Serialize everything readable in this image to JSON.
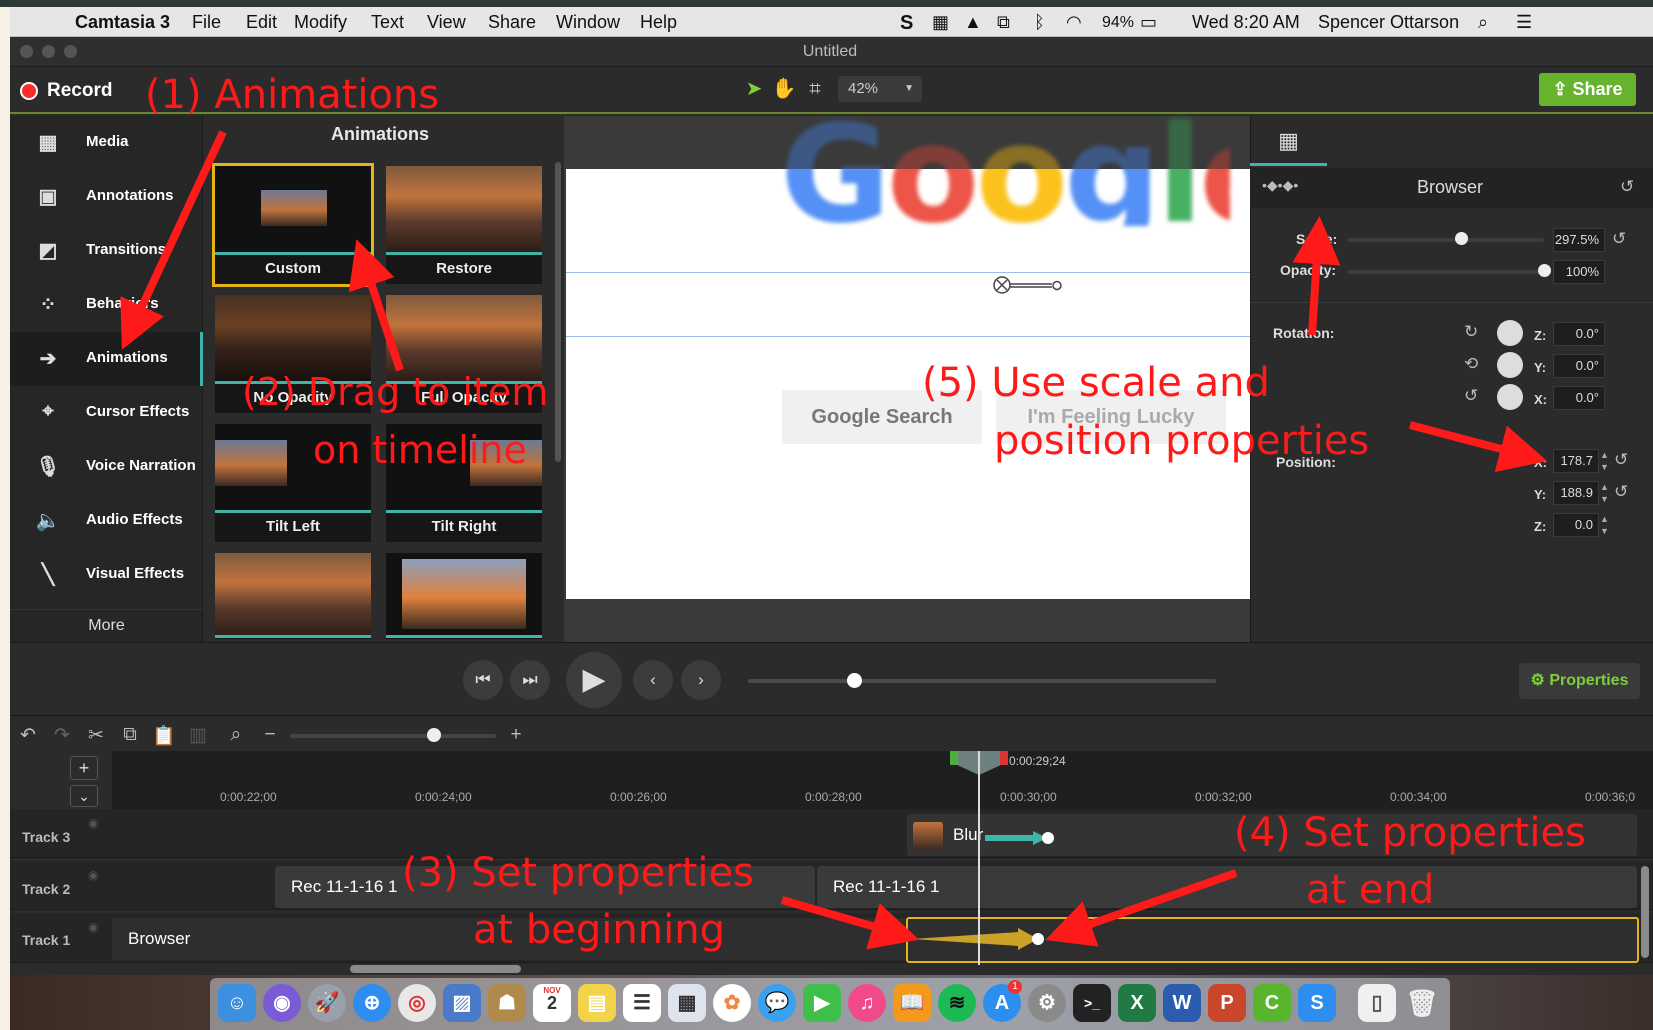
{
  "menubar": {
    "app": "Camtasia 3",
    "items": [
      "File",
      "Edit",
      "Modify",
      "Text",
      "View",
      "Share",
      "Window",
      "Help"
    ],
    "battery": "94%",
    "clock": "Wed 8:20 AM",
    "user": "Spencer Ottarson"
  },
  "window": {
    "title": "Untitled"
  },
  "toolbar": {
    "record_label": "Record",
    "zoom": "42%",
    "share_label": "Share"
  },
  "sidebar": {
    "items": [
      {
        "label": "Media",
        "icon": "film-icon"
      },
      {
        "label": "Annotations",
        "icon": "annotation-icon"
      },
      {
        "label": "Transitions",
        "icon": "transition-icon"
      },
      {
        "label": "Behaviors",
        "icon": "behaviors-icon"
      },
      {
        "label": "Animations",
        "icon": "arrow-right-icon"
      },
      {
        "label": "Cursor Effects",
        "icon": "cursor-icon"
      },
      {
        "label": "Voice Narration",
        "icon": "microphone-icon"
      },
      {
        "label": "Audio Effects",
        "icon": "speaker-icon"
      },
      {
        "label": "Visual Effects",
        "icon": "wand-icon"
      }
    ],
    "more": "More"
  },
  "library": {
    "title": "Animations",
    "items": [
      "Custom",
      "Restore",
      "No Opacity",
      "Full Opacity",
      "Tilt Left",
      "Tilt Right",
      "",
      ""
    ]
  },
  "canvas": {
    "logo": "Google",
    "search_button": "Google Search",
    "lucky_button": "I'm Feeling Lucky"
  },
  "properties": {
    "title": "Browser",
    "scale_label": "Scale:",
    "scale_value": "297.5%",
    "scale_level": 0.58,
    "opacity_label": "Opacity:",
    "opacity_value": "100%",
    "opacity_level": 1.0,
    "rotation_label": "Rotation:",
    "rot_z": "0.0°",
    "rot_y": "0.0°",
    "rot_x": "0.0°",
    "position_label": "Position:",
    "pos_x": "178.7",
    "pos_y": "188.9",
    "pos_z": "0.0",
    "axis_z": "Z:",
    "axis_y": "Y:",
    "axis_x": "X:",
    "button": "Properties"
  },
  "timeline": {
    "playhead_time": "0:00:29;24",
    "ruler": [
      "0:00:22;00",
      "0:00:24;00",
      "0:00:26;00",
      "0:00:28;00",
      "0:00:30;00",
      "0:00:32;00",
      "0:00:34;00",
      "0:00:36;0"
    ],
    "tracks": [
      "Track 3",
      "Track 2",
      "Track 1"
    ],
    "clips": {
      "blur": "Blur",
      "rec_a": "Rec 11-1-16 1",
      "rec_b": "Rec 11-1-16 1",
      "browser": "Browser"
    }
  },
  "annotations": {
    "a1": "(1) Animations",
    "a2_line1": "(2) Drag to item",
    "a2_line2": "on timeline",
    "a3_line1": "(3) Set properties",
    "a3_line2": "at beginning",
    "a4_line1": "(4) Set properties",
    "a4_line2": "at end",
    "a5_line1": "(5) Use scale and",
    "a5_line2": "position properties"
  },
  "dock": {
    "calendar_day": "2",
    "calendar_month": "NOV",
    "appstore_badge": "1"
  },
  "colors": {
    "accent_teal": "#3eb5a8",
    "share_green": "#66b32e",
    "record_red": "#ff2b2b",
    "annotation_red": "#ff1a1a",
    "selection_yellow": "#e6b417"
  }
}
